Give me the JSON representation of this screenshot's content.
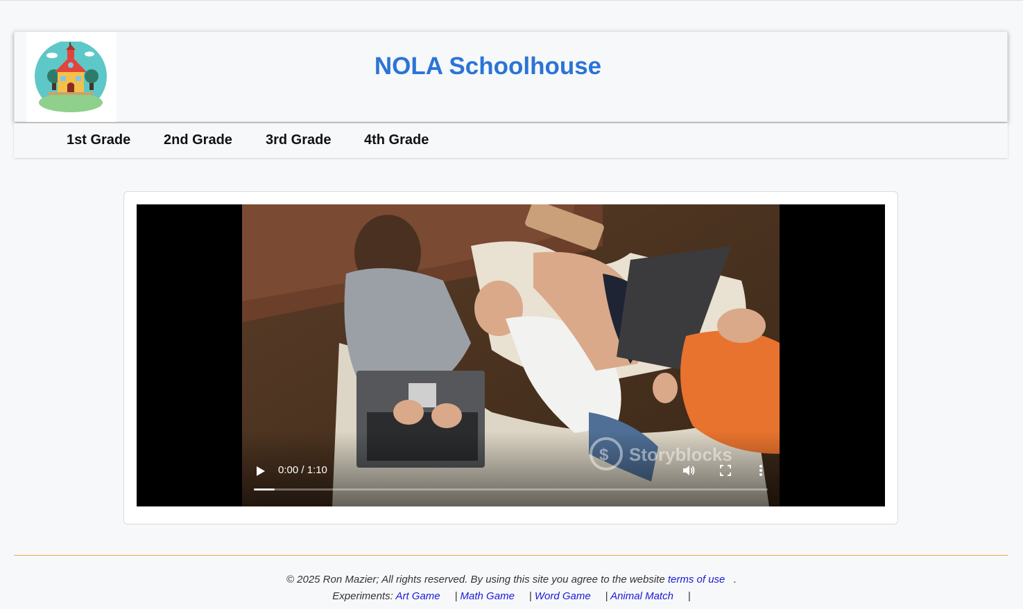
{
  "site": {
    "title": "NOLA Schoolhouse",
    "logo_icon": "schoolhouse-logo-icon"
  },
  "nav": {
    "items": [
      {
        "label": "1st Grade"
      },
      {
        "label": "2nd Grade"
      },
      {
        "label": "3rd Grade"
      },
      {
        "label": "4th Grade"
      }
    ]
  },
  "video": {
    "time": "0:00 / 1:10",
    "progress": 0.04,
    "watermark": "Storyblocks",
    "icons": {
      "play": "play-icon",
      "volume": "volume-icon",
      "fullscreen": "fullscreen-icon",
      "more": "more-options-icon"
    }
  },
  "footer": {
    "copyright": "© 2025 Ron Mazier; All rights reserved. By using this site you agree to the website ",
    "terms_link": "terms of use",
    "terms_suffix": "   .",
    "experiments_label": "Experiments: ",
    "links": [
      {
        "label": "Art Game"
      },
      {
        "label": "Math Game"
      },
      {
        "label": "Word Game"
      },
      {
        "label": "Animal Match"
      }
    ],
    "separator": "|"
  },
  "colors": {
    "title": "#2a74d6",
    "link": "#1a1ad6",
    "footer_rule": "#e5a93a",
    "page_bg": "#f7f8fa"
  }
}
